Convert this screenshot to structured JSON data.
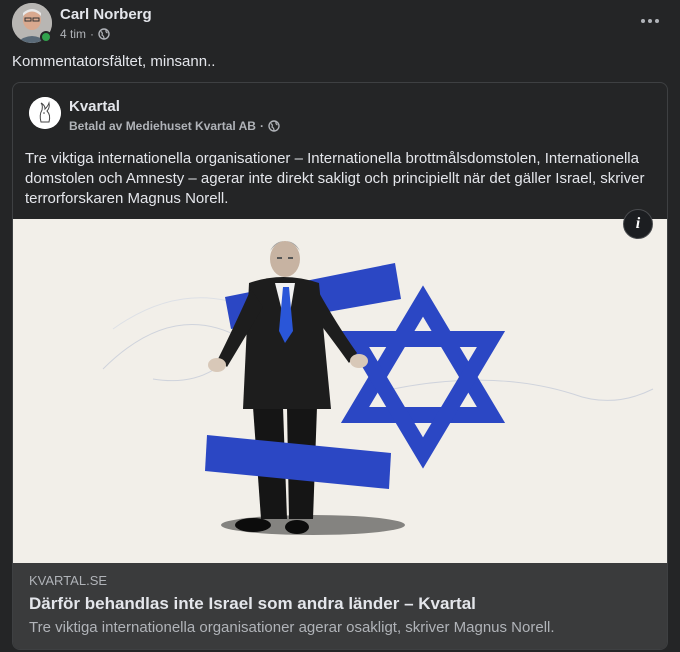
{
  "post": {
    "author": "Carl Norberg",
    "time": "4 tim",
    "privacy_icon": "globe-icon",
    "more_icon": "more-horizontal-icon",
    "text": "Kommentatorsfältet, minsann.."
  },
  "ad": {
    "page_name": "Kvartal",
    "sponsor": "Betald av Mediehuset Kvartal AB",
    "body": "Tre viktiga internationella organisationer – Internationella brottmålsdomstolen, Internationella domstolen och Amnesty – agerar inte direkt sakligt och principiellt när det gäller Israel, skriver terrorforskaren Magnus Norell.",
    "info_icon": "i",
    "link": {
      "domain": "KVARTAL.SE",
      "title": "Därför behandlas inte Israel som andra länder – Kvartal",
      "description": "Tre viktiga internationella organisationer agerar osakligt, skriver Magnus Norell."
    }
  },
  "colors": {
    "background": "#242526",
    "card_footer": "#3a3b3c",
    "primary_text": "#e4e6eb",
    "secondary_text": "#b0b3b8",
    "online": "#31a24c",
    "flag_blue": "#2b47c4"
  }
}
